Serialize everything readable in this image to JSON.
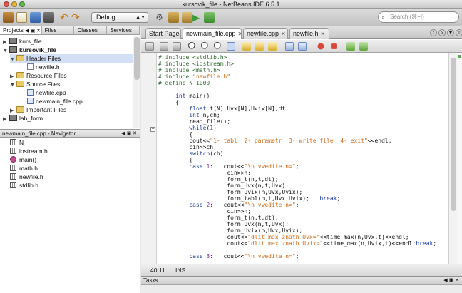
{
  "window": {
    "title": "kursovik_file - NetBeans IDE 6.5.1"
  },
  "toolbar": {
    "configuration": "Debug",
    "search_placeholder": "Search (⌘+I)",
    "icons": [
      "new-project-icon",
      "new-file-icon",
      "open-project-icon",
      "save-all-icon",
      "undo-icon",
      "redo-icon",
      "set-main-project-icon",
      "build-icon",
      "clean-build-icon",
      "run-icon",
      "debug-icon"
    ]
  },
  "left_panel": {
    "tabs": [
      "Projects",
      "Files",
      "Classes",
      "Services"
    ],
    "active_tab": "Projects",
    "tree": [
      {
        "label": "kurs_file",
        "level": 0,
        "icon": "project",
        "expanded": false
      },
      {
        "label": "kursovik_file",
        "level": 0,
        "icon": "project",
        "expanded": true,
        "bold": true
      },
      {
        "label": "Header Files",
        "level": 1,
        "icon": "folder",
        "expanded": true,
        "selected": true
      },
      {
        "label": "newfile.h",
        "level": 2,
        "icon": "file"
      },
      {
        "label": "Resource Files",
        "level": 1,
        "icon": "folder",
        "expanded": false
      },
      {
        "label": "Source Files",
        "level": 1,
        "icon": "folder",
        "expanded": true
      },
      {
        "label": "newfile.cpp",
        "level": 2,
        "icon": "cpp"
      },
      {
        "label": "newmain_file.cpp",
        "level": 2,
        "icon": "cpp"
      },
      {
        "label": "Important Files",
        "level": 1,
        "icon": "folder",
        "expanded": false
      },
      {
        "label": "lab_form",
        "level": 0,
        "icon": "project",
        "expanded": false
      }
    ]
  },
  "navigator": {
    "title": "newmain_file.cpp - Navigator",
    "items": [
      {
        "label": "N",
        "icon": "define"
      },
      {
        "label": "iostream.h",
        "icon": "include"
      },
      {
        "label": "main()",
        "icon": "function"
      },
      {
        "label": "math.h",
        "icon": "include"
      },
      {
        "label": "newfile.h",
        "icon": "include"
      },
      {
        "label": "stdlib.h",
        "icon": "include"
      }
    ]
  },
  "editor": {
    "tabs": [
      "Start Page",
      "newmain_file.cpp",
      "newfile.cpp",
      "newfile.h"
    ],
    "active_tab": "newmain_file.cpp",
    "code": [
      [
        [
          "pp",
          "# include <stdlib.h>"
        ]
      ],
      [
        [
          "pp",
          "# include <iostream.h>"
        ]
      ],
      [
        [
          "pp",
          "# include <math.h>"
        ]
      ],
      [
        [
          "pp",
          "# include "
        ],
        [
          "str",
          "\"newfile.h\""
        ]
      ],
      [
        [
          "pp",
          "# define N 1000"
        ]
      ],
      [
        [
          "t",
          ""
        ]
      ],
      [
        [
          "t",
          "     "
        ],
        [
          "kw",
          "int"
        ],
        [
          "t",
          " main()"
        ]
      ],
      [
        [
          "t",
          "     {"
        ]
      ],
      [
        [
          "t",
          "         "
        ],
        [
          "kw",
          "float"
        ],
        [
          "t",
          " t[N],Uvx[N],Uvix[N],dt;"
        ]
      ],
      [
        [
          "t",
          "         "
        ],
        [
          "kw",
          "int"
        ],
        [
          "t",
          " n,ch;"
        ]
      ],
      [
        [
          "t",
          "         read_file();"
        ]
      ],
      [
        [
          "t",
          "         "
        ],
        [
          "kw",
          "while"
        ],
        [
          "t",
          "("
        ],
        [
          "num",
          "1"
        ],
        [
          "t",
          ")"
        ]
      ],
      [
        [
          "t",
          "         {"
        ]
      ],
      [
        [
          "t",
          "         cout<<"
        ],
        [
          "str",
          "\"1- tabl  2- parametr  3- write file  4- exit\""
        ],
        [
          "t",
          "<<endl;"
        ]
      ],
      [
        [
          "t",
          "         cin>>ch;"
        ]
      ],
      [
        [
          "t",
          "         "
        ],
        [
          "kw",
          "switch"
        ],
        [
          "t",
          "(ch)"
        ]
      ],
      [
        [
          "t",
          "         {"
        ]
      ],
      [
        [
          "t",
          "         "
        ],
        [
          "kw",
          "case"
        ],
        [
          "t",
          " "
        ],
        [
          "num",
          "1"
        ],
        [
          "t",
          ":   cout<<"
        ],
        [
          "str",
          "\"\\n vvedite n=\""
        ],
        [
          "t",
          ";"
        ]
      ],
      [
        [
          "t",
          "                    cin>>n;"
        ]
      ],
      [
        [
          "t",
          "                    form_t(n,t,dt);"
        ]
      ],
      [
        [
          "t",
          "                    form_Uvx(n,t,Uvx);"
        ]
      ],
      [
        [
          "t",
          "                    form_Uvix(n,Uvx,Uvix);"
        ]
      ],
      [
        [
          "t",
          "                    form_tabl(n,t,Uvx,Uvix);   "
        ],
        [
          "kw",
          "break"
        ],
        [
          "t",
          ";"
        ]
      ],
      [
        [
          "t",
          "         "
        ],
        [
          "kw",
          "case"
        ],
        [
          "t",
          " "
        ],
        [
          "num",
          "2"
        ],
        [
          "t",
          ":   cout<<"
        ],
        [
          "str",
          "\"\\n vvedite n=\""
        ],
        [
          "t",
          ";"
        ]
      ],
      [
        [
          "t",
          "                    cin>>n;"
        ]
      ],
      [
        [
          "t",
          "                    form_t(n,t,dt);"
        ]
      ],
      [
        [
          "t",
          "                    form_Uvx(n,t,Uvx);"
        ]
      ],
      [
        [
          "t",
          "                    form_Uvix(n,Uvx,Uvix);"
        ]
      ],
      [
        [
          "t",
          "                    cout<<"
        ],
        [
          "str",
          "\"dlit max znath Uvx=\""
        ],
        [
          "t",
          "<<time_max(n,Uvx,t)<<endl;"
        ]
      ],
      [
        [
          "t",
          "                    cout<<"
        ],
        [
          "str",
          "\"dlit max znath Uvix=\""
        ],
        [
          "t",
          "<<time_max(n,Uvix,t)<<endl;"
        ],
        [
          "kw",
          "break"
        ],
        [
          "t",
          ";"
        ]
      ],
      [
        [
          "t",
          ""
        ]
      ],
      [
        [
          "t",
          "         "
        ],
        [
          "kw",
          "case"
        ],
        [
          "t",
          " "
        ],
        [
          "num",
          "3"
        ],
        [
          "t",
          ":   cout<<"
        ],
        [
          "str",
          "\"\\n vvedite n=\""
        ],
        [
          "t",
          ";"
        ]
      ]
    ],
    "status": {
      "position": "40:11",
      "mode": "INS"
    }
  },
  "tasks_panel": {
    "title": "Tasks"
  }
}
